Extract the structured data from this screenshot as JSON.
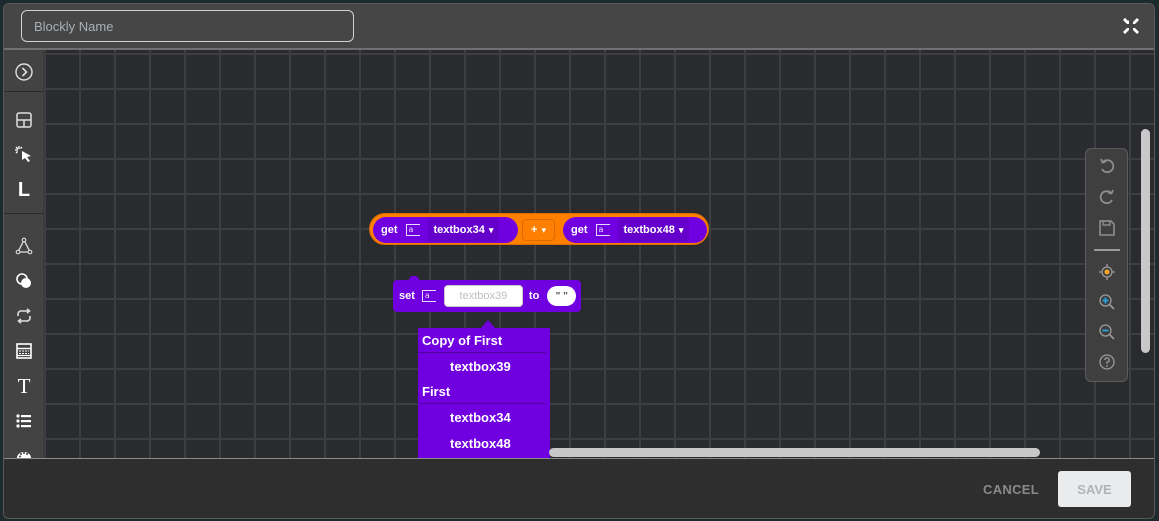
{
  "header": {
    "name_placeholder": "Blockly Name",
    "name_value": "",
    "collapse_icon": "collapse-arrows-icon"
  },
  "toolbox": {
    "items": [
      {
        "icon": "expand-chevron-icon"
      },
      {
        "icon": "layout-icon"
      },
      {
        "icon": "click-pointer-icon"
      },
      {
        "icon": "letter-l-icon",
        "glyph": "L"
      },
      {
        "icon": "logic-triangle-icon"
      },
      {
        "icon": "circles-icon"
      },
      {
        "icon": "loop-icon"
      },
      {
        "icon": "grid-form-icon"
      },
      {
        "icon": "text-t-icon",
        "glyph": "T"
      },
      {
        "icon": "list-icon"
      },
      {
        "icon": "palette-icon"
      }
    ]
  },
  "blocks": {
    "expression": {
      "left": {
        "keyword": "get",
        "variable": "textbox34"
      },
      "operator": "+",
      "right": {
        "keyword": "get",
        "variable": "textbox48"
      },
      "dropdown_arrow": "▾"
    },
    "setter": {
      "keyword": "set",
      "variable_value": "textbox39",
      "to_label": "to",
      "string_value": "\" \""
    }
  },
  "variable_dropdown": {
    "groups": [
      {
        "header": "Copy of First",
        "options": [
          "textbox39"
        ]
      },
      {
        "header": "First",
        "options": [
          "textbox34",
          "textbox48"
        ]
      }
    ]
  },
  "zoom_controls": [
    {
      "icon": "undo-icon"
    },
    {
      "icon": "redo-icon"
    },
    {
      "icon": "save-icon"
    },
    {
      "icon": "recenter-icon"
    },
    {
      "icon": "zoom-in-icon"
    },
    {
      "icon": "zoom-out-icon"
    },
    {
      "icon": "help-icon"
    }
  ],
  "colors": {
    "variable_block": "#7000e0",
    "operator_block": "#ff8000",
    "workspace_bg": "#2a2b2f",
    "zoom_accent": "#29a0e0",
    "recenter_accent": "#f5a623"
  },
  "footer": {
    "cancel_label": "CANCEL",
    "save_label": "SAVE"
  }
}
